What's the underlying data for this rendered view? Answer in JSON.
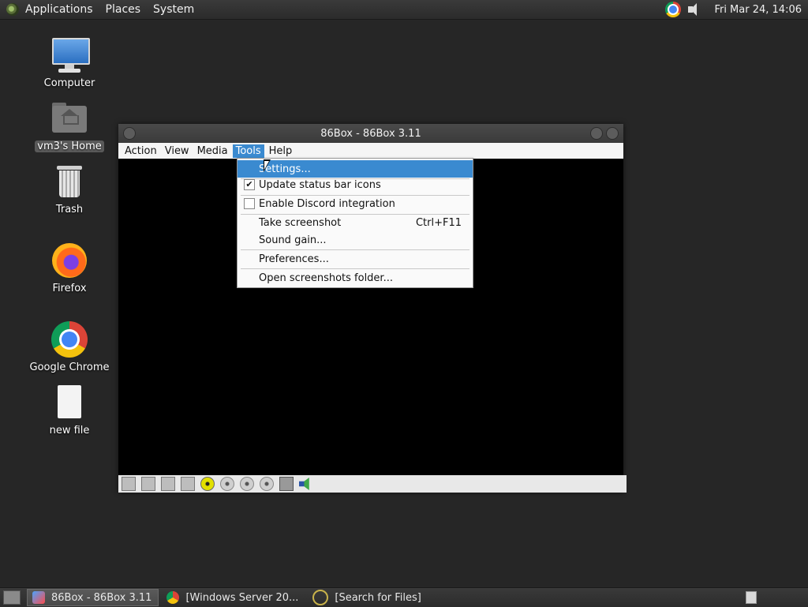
{
  "top_panel": {
    "menus": [
      "Applications",
      "Places",
      "System"
    ],
    "clock": "Fri Mar 24, 14:06"
  },
  "desktop": {
    "icons": [
      {
        "label": "Computer",
        "icon": "computer-icon"
      },
      {
        "label": "vm3's Home",
        "icon": "home-folder-icon"
      },
      {
        "label": "Trash",
        "icon": "trash-icon"
      },
      {
        "label": "Firefox",
        "icon": "firefox-icon"
      },
      {
        "label": "Google Chrome",
        "icon": "chrome-icon"
      },
      {
        "label": "new file",
        "icon": "file-icon"
      }
    ]
  },
  "window": {
    "title": "86Box - 86Box 3.11",
    "menubar": [
      "Action",
      "View",
      "Media",
      "Tools",
      "Help"
    ],
    "active_menu": "Tools"
  },
  "tools_menu": {
    "items": [
      {
        "label": "Settings...",
        "highlighted": true
      },
      {
        "label": "Update status bar icons",
        "checked": true
      },
      {
        "label": "Enable Discord integration",
        "checked": false
      },
      {
        "label": "Take screenshot",
        "shortcut": "Ctrl+F11"
      },
      {
        "label": "Sound gain..."
      },
      {
        "label": "Preferences..."
      },
      {
        "label": "Open screenshots folder..."
      }
    ]
  },
  "taskbar": {
    "tasks": [
      {
        "label": "86Box - 86Box 3.11",
        "active": true
      },
      {
        "label": "[Windows Server 20...",
        "active": false
      },
      {
        "label": "[Search for Files]",
        "active": false
      }
    ]
  },
  "colors": {
    "desktop_bg": "#262626",
    "menu_highlight": "#3a8ad0"
  }
}
